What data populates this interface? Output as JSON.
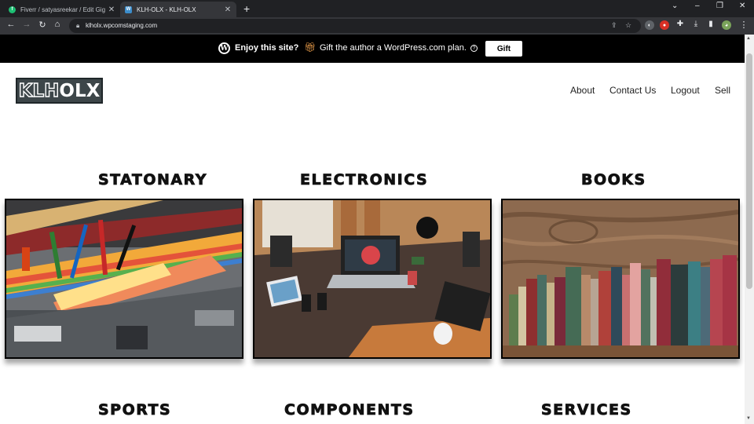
{
  "browser": {
    "tabs": [
      {
        "title": "Fiverr / satyasreekar / Edit Gig",
        "active": false
      },
      {
        "title": "KLH-OLX - KLH-OLX",
        "active": true
      }
    ],
    "url": "klholx.wpcomstaging.com"
  },
  "banner": {
    "enjoy": "Enjoy this site?",
    "gift_text": "Gift the author a WordPress.com plan.",
    "gift_button": "Gift"
  },
  "site": {
    "logo_part1": "KLH",
    "logo_part2": "OLX",
    "nav": [
      "About",
      "Contact Us",
      "Logout",
      "Sell"
    ]
  },
  "categories": [
    {
      "title": "STATONARY",
      "image": "stationery-case-photo"
    },
    {
      "title": "ELECTRONICS",
      "image": "desk-electronics-photo"
    },
    {
      "title": "BOOKS",
      "image": "books-shelf-photo"
    },
    {
      "title": "SPORTS"
    },
    {
      "title": "COMPONENTS"
    },
    {
      "title": "SERVICES"
    }
  ],
  "colors": {
    "banner_bg": "#000000",
    "chrome_dark": "#202124",
    "chrome_toolbar": "#35363a",
    "logo_bg": "#3d4649"
  }
}
